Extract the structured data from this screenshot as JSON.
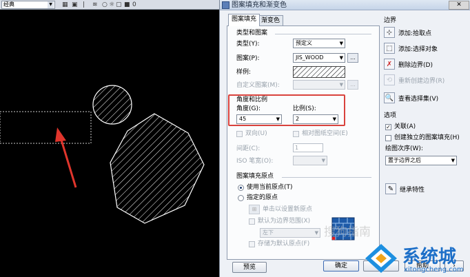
{
  "cad": {
    "layer_combo": "经典",
    "layer_state_icon": "bulb-sun-lock-icons",
    "layer_value": "0"
  },
  "dialog": {
    "title": "图案填充和渐变色",
    "tabs": [
      "图案填充",
      "渐变色"
    ],
    "type_pattern": {
      "section": "类型和图案",
      "type_label": "类型(Y):",
      "type_value": "预定义",
      "pattern_label": "图案(P):",
      "pattern_value": "JIS_WOOD",
      "pattern_browse": "...",
      "swatch_label": "样例:",
      "custom_label": "自定义图案(M):",
      "custom_browse": "..."
    },
    "angle_scale": {
      "section": "角度和比例",
      "angle_label": "角度(G):",
      "angle_value": "45",
      "scale_label": "比例(S):",
      "scale_value": "2",
      "double_label": "双向(U)",
      "relative_label": "相对图纸空间(E)",
      "spacing_label": "间距(C):",
      "spacing_value": "1",
      "iso_label": "ISO 笔宽(O):"
    },
    "origin": {
      "section": "图案填充原点",
      "use_current": "使用当前原点(T)",
      "specify": "指定的原点",
      "click_set": "单击以设置新原点",
      "default_extent": "默认为边界范围(X)",
      "extent_value": "左下",
      "store_default": "存储为默认原点(F)"
    },
    "boundaries": {
      "section": "边界",
      "items": [
        "添加:拾取点",
        "添加:选择对象",
        "删除边界(D)",
        "重新创建边界(R)",
        "查看选择集(V)"
      ]
    },
    "options": {
      "section": "选项",
      "associative": "关联(A)",
      "separate": "创建独立的图案填充(H)",
      "draw_order_label": "绘图次序(W):",
      "draw_order_value": "置于边界之后",
      "inherit": "继承特性"
    },
    "buttons": {
      "preview": "预览",
      "ok": "确定",
      "cancel": "取消",
      "help": "帮助"
    }
  },
  "watermark": {
    "sogou": "搜狗指南",
    "site_cn": "系统城",
    "site_url": "xitongcheng.com"
  },
  "colors": {
    "highlight_box": "#d9423c",
    "arrow": "#e0352c",
    "cad_background": "#000000"
  }
}
